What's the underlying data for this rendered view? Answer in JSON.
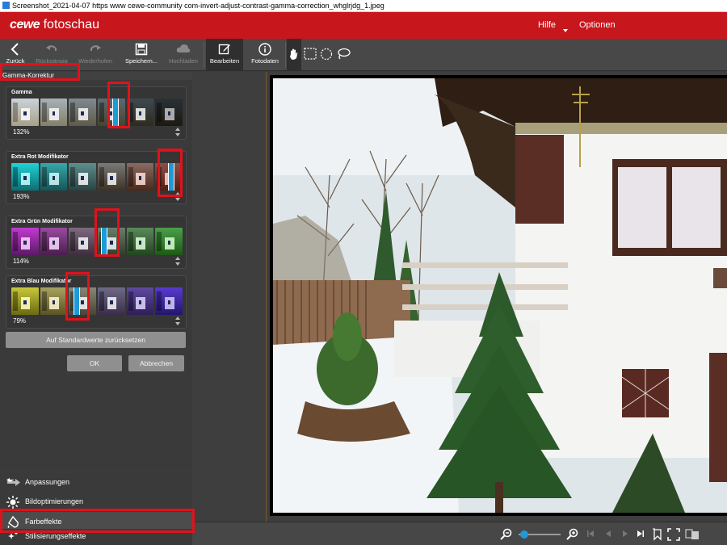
{
  "window": {
    "title": "Screenshot_2021-04-07 https www cewe-community com-invert-adjust-contrast-gamma-correction_whglrjdg_1.jpeg"
  },
  "header": {
    "logo_brand": "cewe",
    "logo_product": "fotoschau",
    "help_label": "Hilfe",
    "options_label": "Optionen",
    "color": "#c8161d"
  },
  "toolbar": {
    "back": "Zurück",
    "undo": "Rückgängig",
    "redo": "Wiederholen",
    "save": "Speichern...",
    "upload": "Hochladen",
    "edit": "Bearbeiten",
    "photo_data": "Fotodaten",
    "tools": [
      "hand-icon",
      "rect-select-icon",
      "ellipse-select-icon",
      "lasso-icon"
    ]
  },
  "panel": {
    "title": "Gamma-Korrektur",
    "groups": [
      {
        "label": "Gamma",
        "value": "132%"
      },
      {
        "label": "Extra Rot Modifikator",
        "value": "193%"
      },
      {
        "label": "Extra Grün Modifikator",
        "value": "114%"
      },
      {
        "label": "Extra Blau Modifikator",
        "value": "79%"
      }
    ],
    "reset_label": "Auf Standardwerte zurücksetzen",
    "ok_label": "OK",
    "cancel_label": "Abbrechen"
  },
  "nav": {
    "items": [
      {
        "label": "Anpassungen",
        "icon": "adjust-arrows-icon"
      },
      {
        "label": "Bildoptimierungen",
        "icon": "sun-icon"
      },
      {
        "label": "Farbeffekte",
        "icon": "paint-drop-icon",
        "selected": true
      },
      {
        "label": "Stilisierungseffekte",
        "icon": "sparkle-icon"
      }
    ]
  },
  "accent_colors": {
    "highlight": "#e0121b",
    "marker": "#1e9ad6"
  },
  "statusbar": {
    "zoom_level": 0.03,
    "icons": [
      "zoom-out-icon",
      "zoom-slider",
      "zoom-in-icon",
      "first-icon",
      "prev-icon",
      "next-icon",
      "last-icon",
      "bookmark-icon",
      "fullscreen-icon",
      "compare-icon"
    ]
  }
}
